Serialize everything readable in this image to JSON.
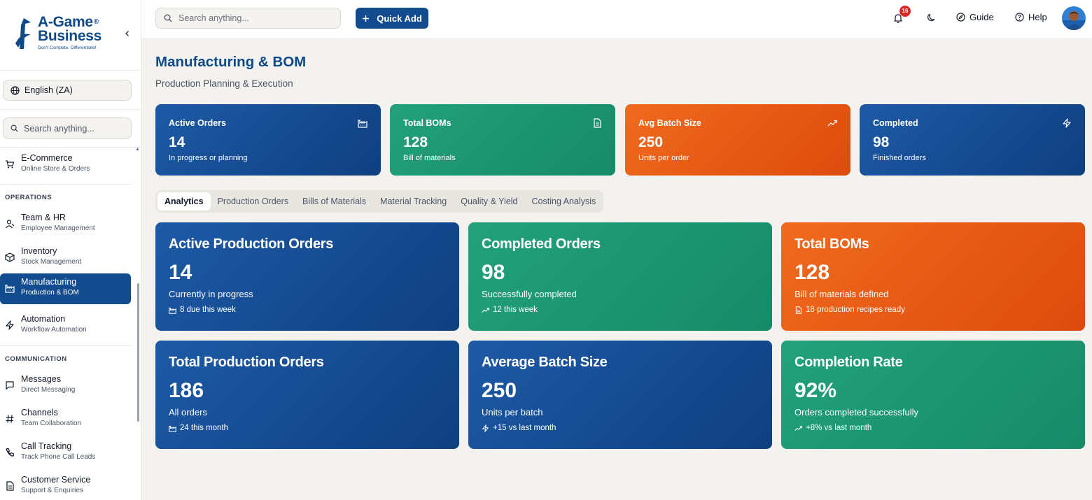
{
  "brand": {
    "name_line1": "A-Game",
    "name_line2": "Business",
    "registered": "®",
    "tagline": "Don't Compete. Differentiate!",
    "color": "#0e4a8a"
  },
  "sidebar": {
    "language": "English (ZA)",
    "search_placeholder": "Search anything...",
    "top_item": {
      "title": "E-Commerce",
      "subtitle": "Online Store & Orders",
      "icon": "cart-icon"
    },
    "sections": [
      {
        "label": "OPERATIONS",
        "items": [
          {
            "title": "Team & HR",
            "subtitle": "Employee Management",
            "icon": "users-icon"
          },
          {
            "title": "Inventory",
            "subtitle": "Stock Management",
            "icon": "box-icon"
          },
          {
            "title": "Manufacturing",
            "subtitle": "Production & BOM",
            "icon": "factory-icon",
            "active": true
          },
          {
            "title": "Automation",
            "subtitle": "Workflow Automation",
            "icon": "bolt-icon"
          }
        ]
      },
      {
        "label": "COMMUNICATION",
        "items": [
          {
            "title": "Messages",
            "subtitle": "Direct Messaging",
            "icon": "message-icon"
          },
          {
            "title": "Channels",
            "subtitle": "Team Collaboration",
            "icon": "hash-icon"
          },
          {
            "title": "Call Tracking",
            "subtitle": "Track Phone Call Leads",
            "icon": "phone-icon"
          },
          {
            "title": "Customer Service",
            "subtitle": "Support & Enquiries",
            "icon": "document-icon"
          }
        ]
      }
    ]
  },
  "topbar": {
    "search_placeholder": "Search anything...",
    "quick_add_label": "Quick Add",
    "notification_count": "16",
    "guide_label": "Guide",
    "help_label": "Help"
  },
  "page": {
    "title": "Manufacturing & BOM",
    "subtitle": "Production Planning & Execution"
  },
  "stat_cards": [
    {
      "label": "Active Orders",
      "value": "14",
      "desc": "In progress or planning",
      "icon": "factory-icon",
      "color": "blue"
    },
    {
      "label": "Total BOMs",
      "value": "128",
      "desc": "Bill of materials",
      "icon": "document-icon",
      "color": "green"
    },
    {
      "label": "Avg Batch Size",
      "value": "250",
      "desc": "Units per order",
      "icon": "trend-up-icon",
      "color": "orange"
    },
    {
      "label": "Completed",
      "value": "98",
      "desc": "Finished orders",
      "icon": "bolt-icon",
      "color": "blue"
    }
  ],
  "tabs": [
    "Analytics",
    "Production Orders",
    "Bills of Materials",
    "Material Tracking",
    "Quality & Yield",
    "Costing Analysis"
  ],
  "active_tab": "Analytics",
  "analytics_cards": [
    {
      "title": "Active Production Orders",
      "value": "14",
      "desc": "Currently in progress",
      "foot": "8 due this week",
      "foot_icon": "factory-icon",
      "color": "blue"
    },
    {
      "title": "Completed Orders",
      "value": "98",
      "desc": "Successfully completed",
      "foot": "12 this week",
      "foot_icon": "trend-up-icon",
      "color": "green"
    },
    {
      "title": "Total BOMs",
      "value": "128",
      "desc": "Bill of materials defined",
      "foot": "18 production recipes ready",
      "foot_icon": "document-icon",
      "color": "orange"
    },
    {
      "title": "Total Production Orders",
      "value": "186",
      "desc": "All orders",
      "foot": "24 this month",
      "foot_icon": "factory-icon",
      "color": "blue"
    },
    {
      "title": "Average Batch Size",
      "value": "250",
      "desc": "Units per batch",
      "foot": "+15 vs last month",
      "foot_icon": "bolt-icon",
      "color": "blue"
    },
    {
      "title": "Completion Rate",
      "value": "92%",
      "desc": "Orders completed successfully",
      "foot": "+8% vs last month",
      "foot_icon": "trend-up-icon",
      "color": "green"
    }
  ],
  "colors": {
    "primary": "#124c8f",
    "blue": "#1d5aa6",
    "green": "#22a17a",
    "orange": "#f06a1e",
    "badge": "#dc2626"
  }
}
